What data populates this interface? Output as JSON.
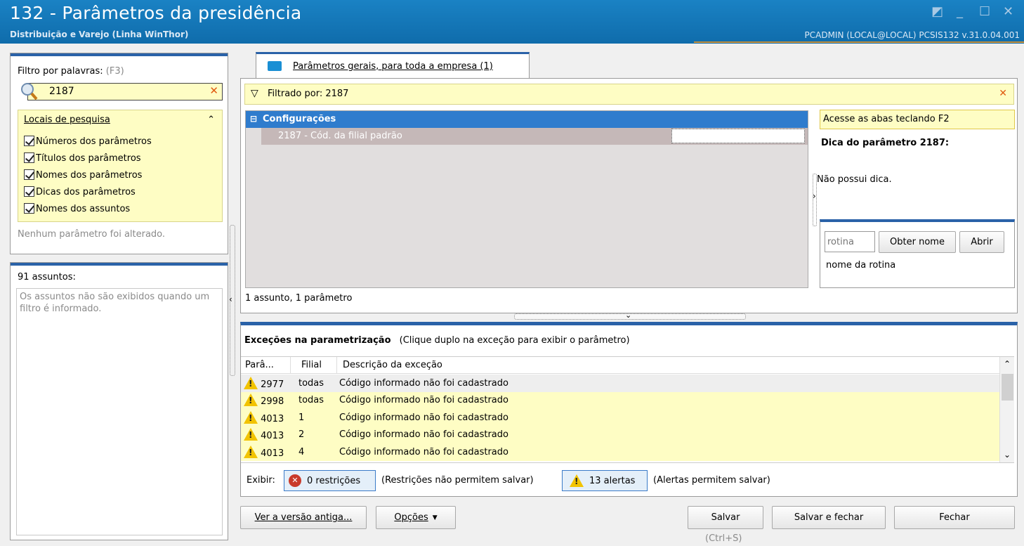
{
  "window": {
    "title": "132 - Parâmetros da presidência",
    "subtitle": "Distribuição e Varejo (Linha WinThor)",
    "user_info": "PCADMIN (LOCAL@LOCAL)   PCSIS132  v.31.0.04.001"
  },
  "filter": {
    "label": "Filtro por palavras:",
    "shortcut": "(F3)",
    "value": "2187",
    "search_locations_title": "Locais de pesquisa",
    "options": [
      "Números dos parâmetros",
      "Títulos dos parâmetros",
      "Nomes dos parâmetros",
      "Dicas dos parâmetros",
      "Nomes dos assuntos"
    ],
    "status": "Nenhum parâmetro foi alterado."
  },
  "subjects": {
    "count_label": "91 assuntos:",
    "note": "Os assuntos não são exibidos quando um filtro é informado."
  },
  "tab": {
    "label": "Parâmetros gerais, para toda a empresa  (1)"
  },
  "filtered_bar": {
    "text": "Filtrado por: 2187"
  },
  "tree": {
    "group": "Configurações",
    "item": "2187 - Cód. da filial padrão",
    "summary": "1 assunto, 1 parâmetro"
  },
  "hint": {
    "tabs_hint": "Acesse as abas teclando F2",
    "title": "Dica do parâmetro 2187:",
    "text": "Não possui dica.",
    "routine_placeholder": "rotina",
    "get_name_button": "Obter nome",
    "open_button": "Abrir",
    "routine_name": "nome da rotina"
  },
  "exceptions": {
    "title": "Exceções na parametrização",
    "subtitle": "(Clique duplo na exceção para exibir o parâmetro)",
    "columns": [
      "Parâ...",
      "Filial",
      "Descrição da exceção"
    ],
    "rows": [
      {
        "param": "2977",
        "branch": "todas",
        "desc": "Código informado não foi cadastrado"
      },
      {
        "param": "2998",
        "branch": "todas",
        "desc": "Código informado não foi cadastrado"
      },
      {
        "param": "4013",
        "branch": "1",
        "desc": "Código informado não foi cadastrado"
      },
      {
        "param": "4013",
        "branch": "2",
        "desc": "Código informado não foi cadastrado"
      },
      {
        "param": "4013",
        "branch": "4",
        "desc": "Código informado não foi cadastrado"
      }
    ],
    "show_label": "Exibir:",
    "restrictions_button": "0 restrições",
    "restrictions_note": "(Restrições não permitem salvar)",
    "alerts_button": "13 alertas",
    "alerts_note": "(Alertas permitem salvar)"
  },
  "footer": {
    "old_version": "Ver a versão antiga...",
    "options": "Opções",
    "save": "Salvar",
    "save_shortcut": "(Ctrl+S)",
    "save_close": "Salvar e fechar",
    "close": "Fechar"
  },
  "colors": {
    "title_bar": "#1377b8",
    "accent_blue": "#2a62a8",
    "highlight_yellow": "#fefdc4",
    "selected_row": "#c5b8b8",
    "warning": "#f2c300"
  }
}
